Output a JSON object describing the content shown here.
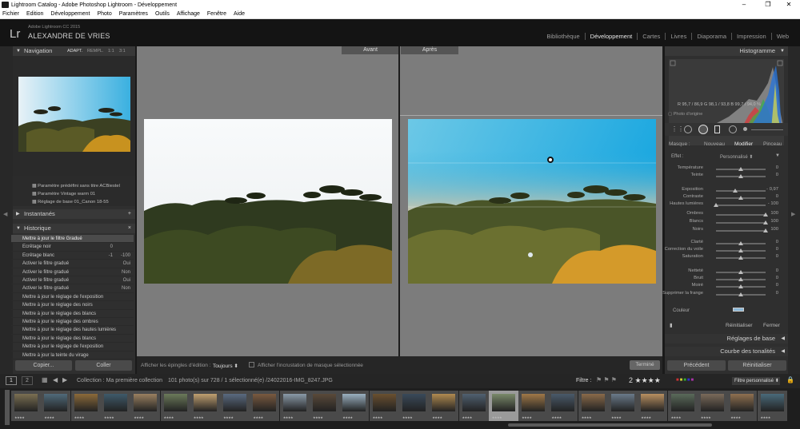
{
  "window": {
    "title": "Lightroom Catalog - Adobe Photoshop Lightroom - Développement",
    "min": "–",
    "max": "❐",
    "close": "✕"
  },
  "menu": [
    "Fichier",
    "Edition",
    "Développement",
    "Photo",
    "Paramètres",
    "Outils",
    "Affichage",
    "Fenêtre",
    "Aide"
  ],
  "identity": {
    "logo": "Lr",
    "version": "Adobe Lightroom CC 2015",
    "name": "ALEXANDRE DE VRIES"
  },
  "modules": [
    "Bibliothèque",
    "Développement",
    "Cartes",
    "Livres",
    "Diaporama",
    "Impression",
    "Web"
  ],
  "left": {
    "navigator": {
      "title": "Navigation",
      "zoom": [
        "ADAPT.",
        "REMPL.",
        "1:1",
        "3:1"
      ]
    },
    "presets": [
      "Paramètre prédéfini sans titre ACBiestel",
      "Paramètre Vintage warm 01",
      "Réglage de base 01_Canon 18-55"
    ],
    "snapshots": {
      "title": "Instantanés",
      "add": "+"
    },
    "history": {
      "title": "Historique",
      "clear": "×",
      "items": [
        {
          "label": "Mettre à jour le filtre Gradué",
          "a": "",
          "b": ""
        },
        {
          "label": "Ecrêtage noir",
          "a": "0",
          "b": ""
        },
        {
          "label": "Ecrêtage blanc",
          "a": "-1",
          "b": "-100"
        },
        {
          "label": "Activer le filtre gradué",
          "a": "",
          "b": "Oui"
        },
        {
          "label": "Activer le filtre gradué",
          "a": "",
          "b": "Non"
        },
        {
          "label": "Activer le filtre gradué",
          "a": "",
          "b": "Oui"
        },
        {
          "label": "Activer le filtre gradué",
          "a": "",
          "b": "Non"
        },
        {
          "label": "Mettre à jour le réglage de l'exposition",
          "a": "",
          "b": ""
        },
        {
          "label": "Mettre à jour le réglage des noirs",
          "a": "",
          "b": ""
        },
        {
          "label": "Mettre à jour le réglage des blancs",
          "a": "",
          "b": ""
        },
        {
          "label": "Mettre à jour le réglage des ombres",
          "a": "",
          "b": ""
        },
        {
          "label": "Mettre à jour le réglage des hautes lumières",
          "a": "",
          "b": ""
        },
        {
          "label": "Mettre à jour le réglage des blancs",
          "a": "",
          "b": ""
        },
        {
          "label": "Mettre à jour le réglage de l'exposition",
          "a": "",
          "b": ""
        },
        {
          "label": "Mettre à jour la teinte du virage",
          "a": "",
          "b": ""
        }
      ]
    },
    "copy_button": "Copier...",
    "paste_button": "Coller"
  },
  "center": {
    "before": "Avant",
    "after": "Après"
  },
  "toolbar": {
    "show_pins": "Afficher les épingles d'édition :",
    "pins_value": "Toujours",
    "overlay": "Afficher l'incrustation de masque sélectionnée",
    "done": "Terminé"
  },
  "right": {
    "histogram": {
      "title": "Histogramme",
      "rgb": "R 95,7 / 86,9  G 98,1 / 93,8  B 99,7 / 94,0 %",
      "original": "Photo d'origine"
    },
    "mask": {
      "label": "Masque :",
      "new": "Nouveau",
      "edit": "Modifier",
      "brush": "Pinceau"
    },
    "effect": {
      "label": "Effet :",
      "value": "Personnalisé"
    },
    "sliders": [
      {
        "label": "Température",
        "value": "0",
        "pos": 0.5
      },
      {
        "label": "Teinte",
        "value": "0",
        "pos": 0.5
      },
      {
        "label": "Exposition",
        "value": "- 0,97",
        "pos": 0.38
      },
      {
        "label": "Contraste",
        "value": "0",
        "pos": 0.5
      },
      {
        "label": "Hautes lumières",
        "value": "- 100",
        "pos": 0.0
      },
      {
        "label": "Ombres",
        "value": "100",
        "pos": 1.0
      },
      {
        "label": "Blancs",
        "value": "100",
        "pos": 1.0
      },
      {
        "label": "Noirs",
        "value": "100",
        "pos": 1.0
      },
      {
        "label": "Clarté",
        "value": "0",
        "pos": 0.5
      },
      {
        "label": "Correction du voile",
        "value": "0",
        "pos": 0.5
      },
      {
        "label": "Saturation",
        "value": "0",
        "pos": 0.5
      },
      {
        "label": "Netteté",
        "value": "0",
        "pos": 0.5
      },
      {
        "label": "Bruit",
        "value": "0",
        "pos": 0.5
      },
      {
        "label": "Moiré",
        "value": "0",
        "pos": 0.5
      },
      {
        "label": "Supprimer la frange",
        "value": "0",
        "pos": 0.5
      }
    ],
    "color_label": "Couleur",
    "reset": "Réinitialiser",
    "close": "Fermer",
    "basic": "Réglages de base",
    "tone_curve": "Courbe des tonalités",
    "prev_button": "Précédent",
    "reset_button": "Réinitialiser"
  },
  "filmstrip": {
    "pages": [
      "1",
      "2"
    ],
    "source": "Collection : Ma première collection",
    "count": "101 photo(s) sur 728 / 1 sélectionné(e) /24022016-IMG_8247.JPG",
    "filter_label": "Filtre :",
    "rating": "2 ★★★★",
    "filter_value": "Filtre personnalisé"
  },
  "colors": {
    "accent": "#e8e8e8",
    "panel": "#2f2f2f",
    "center": "#7c7c7c"
  }
}
